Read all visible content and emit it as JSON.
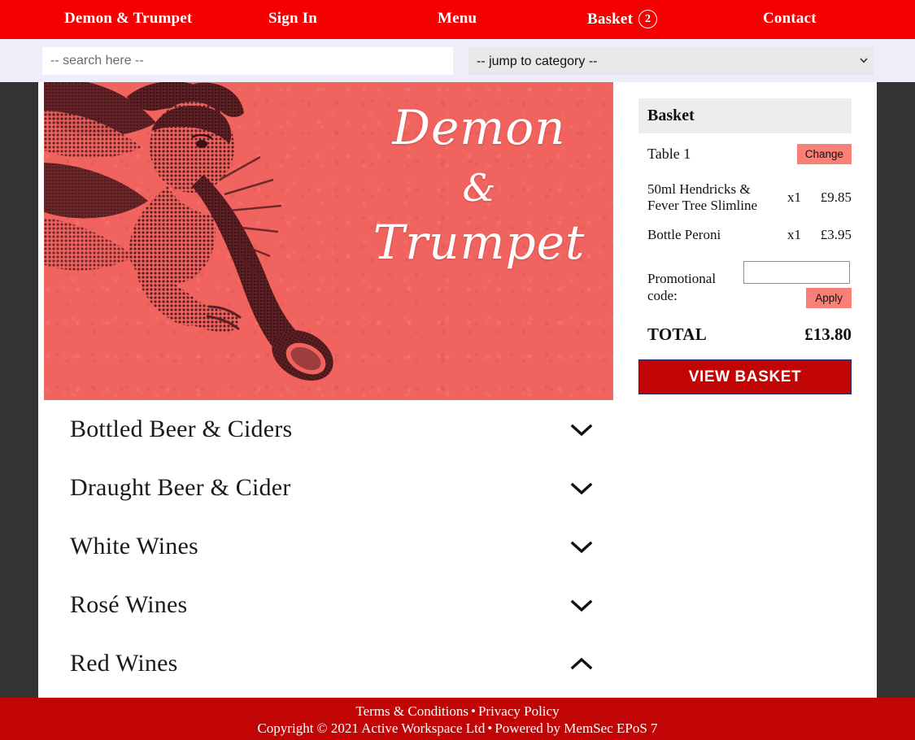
{
  "nav": {
    "brand": "Demon & Trumpet",
    "sign_in": "Sign In",
    "menu": "Menu",
    "basket": "Basket",
    "basket_count": "2",
    "contact": "Contact"
  },
  "search": {
    "placeholder": "-- search here --",
    "value": "",
    "category_selected": "-- jump to category --",
    "category_options": [
      "-- jump to category --"
    ]
  },
  "hero": {
    "line1": "Demon",
    "amp": "&",
    "line3": "Trumpet",
    "background_color": "#f0635e",
    "illustration": "cherub-blowing-trumpet"
  },
  "categories": [
    {
      "label": "Bottled Beer & Ciders",
      "state": "collapsed",
      "icon": "chevron-down-icon"
    },
    {
      "label": "Draught Beer & Cider",
      "state": "collapsed",
      "icon": "chevron-down-icon"
    },
    {
      "label": "White Wines",
      "state": "collapsed",
      "icon": "chevron-down-icon"
    },
    {
      "label": "Rosé Wines",
      "state": "collapsed",
      "icon": "chevron-down-icon"
    },
    {
      "label": "Red Wines",
      "state": "expanded",
      "icon": "chevron-up-icon"
    }
  ],
  "basket": {
    "header": "Basket",
    "table_label": "Table 1",
    "change_label": "Change",
    "items": [
      {
        "name": "50ml Hendricks & Fever Tree Slimline",
        "qty": "x1",
        "price": "£9.85"
      },
      {
        "name": "Bottle Peroni",
        "qty": "x1",
        "price": "£3.95"
      }
    ],
    "promo_label": "Promotional code:",
    "promo_value": "",
    "apply_label": "Apply",
    "total_label": "TOTAL",
    "total_value": "£13.80",
    "view_basket_label": "VIEW BASKET"
  },
  "footer": {
    "terms": "Terms & Conditions",
    "bullet": "•",
    "privacy": "Privacy Policy",
    "copyright": "Copyright © 2021 Active Workspace Ltd",
    "powered": "Powered by MemSec EPoS 7"
  },
  "colors": {
    "nav_red": "#f40000",
    "footer_red": "#c10505",
    "hero_coral": "#f0635e",
    "accent_salmon": "#f98077",
    "page_bg": "#333333"
  }
}
